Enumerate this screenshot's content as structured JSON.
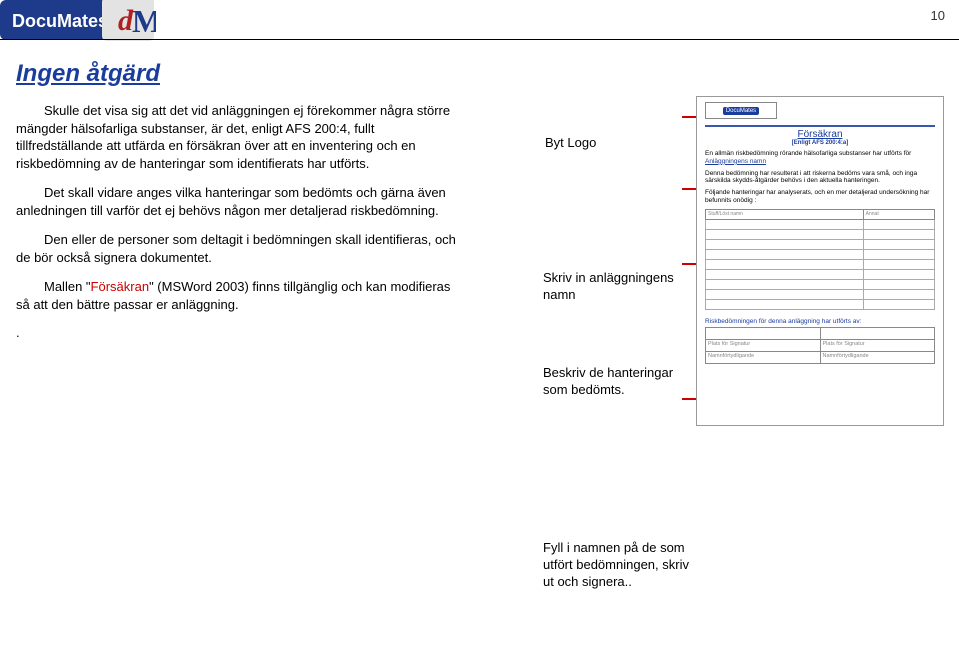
{
  "page_number": "10",
  "logo": {
    "brand_text": "DocuMates",
    "monogram_d": "d",
    "monogram_m": "M"
  },
  "title": "Ingen åtgärd",
  "paragraphs": [
    {
      "text": "Skulle det visa sig att det vid anläggningen ej förekommer några större mängder hälsofarliga substanser, är det, enligt AFS 200:4, fullt tillfredställande att utfärda en försäkran över att en inventering och en riskbedömning av de hanteringar som identifierats har utförts."
    },
    {
      "text": "Det skall vidare anges vilka hanteringar som bedömts och gärna även anledningen till varför det ej behövs någon mer detaljerad riskbedömning."
    },
    {
      "text": "Den eller de personer som deltagit i bedömningen skall identifieras, och de bör också signera dokumentet."
    },
    {
      "prefix": "Mallen \"",
      "highlight": "Försäkran",
      "suffix": "\" (MSWord 2003) finns tillgänglig och kan modifieras så att den bättre passar er anläggning."
    }
  ],
  "trailing_dot": ".",
  "annotations": {
    "logo": "Byt Logo",
    "name": "Skriv in anläggningens namn",
    "handlings": "Beskriv de hanteringar som bedömts.",
    "signers": "Fyll i namnen på de som utfört bedömningen, skriv ut och signera.."
  },
  "preview": {
    "brand_text": "DocuMates",
    "title": "Försäkran",
    "subtitle": "[Enligt AFS 200:4:a]",
    "body_line1_a": "En allmän riskbedömning rörande hälsofarliga substanser har utförts för",
    "body_line1_link": "Anläggningens namn",
    "body_line2": "Denna bedömning har resulterat i att riskerna bedöms vara små, och inga särskilda skydds-åtgärder behövs i den aktuella hanteringen.",
    "body_line3": "Följande hanteringar har analyserats, och en mer detaljerad undersökning har befunnits onödig :",
    "table_headers": {
      "c1": "Stuff/Löst namn",
      "c2": "Annat"
    },
    "sig_heading": "Riskbedömningen för denna anläggning har utförts av:",
    "sig_labels": {
      "l1": "Plats för Signatur",
      "l2": "Plats för Signatur",
      "l3": "Namnförtydligande",
      "l4": "Namnförtydligande"
    }
  }
}
